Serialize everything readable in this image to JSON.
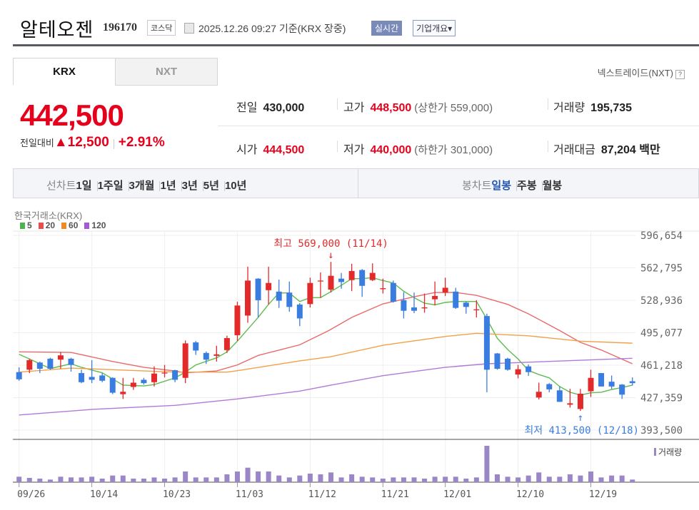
{
  "header": {
    "name": "알테오젠",
    "code": "196170",
    "market": "코스닥",
    "datetime": "2025.12.26 09:27 기준(KRX 장중)",
    "realtime": "실시간",
    "company_overview": "기업개요▾"
  },
  "tabs": [
    {
      "label": "KRX"
    },
    {
      "label": "NXT"
    }
  ],
  "nextrade": {
    "label": "넥스트레이드(NXT)",
    "help": "?"
  },
  "price": {
    "current": "442,500",
    "change_label": "전일대비",
    "change": "▲12,500",
    "rate": "+2.91%"
  },
  "stats": {
    "prev": {
      "label": "전일",
      "value": "430,000"
    },
    "high": {
      "label": "고가",
      "value": "448,500",
      "limit": "(상한가 559,000)"
    },
    "volume": {
      "label": "거래량",
      "value": "195,735"
    },
    "open": {
      "label": "시가",
      "value": "444,500"
    },
    "low": {
      "label": "저가",
      "value": "440,000",
      "limit": "(하한가 301,000)"
    },
    "amount": {
      "label": "거래대금",
      "value": "87,204 백만"
    }
  },
  "toolbar": {
    "line_label": "선차트",
    "line_items": [
      "1일",
      "1주일",
      "3개월",
      "1년",
      "3년",
      "5년",
      "10년"
    ],
    "candle_label": "봉차트",
    "candle_items": [
      "일봉",
      "주봉",
      "월봉"
    ],
    "selected": "일봉"
  },
  "chart_meta": {
    "exchange": "한국거래소(KRX)",
    "legend": [
      {
        "label": "5",
        "color": "#4db34d"
      },
      {
        "label": "20",
        "color": "#e84c4c"
      },
      {
        "label": "60",
        "color": "#f08a24"
      },
      {
        "label": "120",
        "color": "#a25bd4"
      }
    ],
    "volume_legend": "거래량",
    "up_color": "#e32a2a",
    "down_color": "#3a7de0",
    "volume_color": "#9b86c6"
  },
  "chart_data": {
    "type": "candlestick",
    "y_ticks": [
      {
        "value": 596654,
        "label": "596,654"
      },
      {
        "value": 562795,
        "label": "562,795"
      },
      {
        "value": 528936,
        "label": "528,936"
      },
      {
        "value": 495077,
        "label": "495,077"
      },
      {
        "value": 461218,
        "label": "461,218"
      },
      {
        "value": 427359,
        "label": "427,359"
      },
      {
        "value": 393500,
        "label": "393,500"
      }
    ],
    "x_ticks": [
      {
        "index": 1,
        "label": "09/26"
      },
      {
        "index": 8,
        "label": "10/14"
      },
      {
        "index": 15,
        "label": "10/23"
      },
      {
        "index": 22,
        "label": "11/03"
      },
      {
        "index": 29,
        "label": "11/12"
      },
      {
        "index": 36,
        "label": "11/21"
      },
      {
        "index": 42,
        "label": "12/01"
      },
      {
        "index": 49,
        "label": "12/10"
      },
      {
        "index": 56,
        "label": "12/19"
      }
    ],
    "annotations": {
      "high": {
        "index": 31,
        "value": 569000,
        "label": "최고 569,000 (11/14)"
      },
      "low": {
        "index": 55,
        "value": 413500,
        "label": "최저 413,500 (12/18)"
      }
    },
    "ohlc": [
      [
        454000,
        459000,
        445000,
        446500
      ],
      [
        456500,
        468000,
        453000,
        466500
      ],
      [
        464000,
        465000,
        453000,
        457500
      ],
      [
        468000,
        469000,
        456500,
        457500
      ],
      [
        467000,
        475000,
        457500,
        471500
      ],
      [
        468000,
        469000,
        454500,
        461500
      ],
      [
        453000,
        456500,
        442500,
        443500
      ],
      [
        449000,
        466500,
        442500,
        446000
      ],
      [
        450500,
        453000,
        443500,
        445000
      ],
      [
        448000,
        448500,
        431000,
        432500
      ],
      [
        431000,
        448000,
        426000,
        433500
      ],
      [
        438500,
        448000,
        435500,
        443000
      ],
      [
        446000,
        448000,
        441000,
        442500
      ],
      [
        443500,
        460000,
        439000,
        452500
      ],
      [
        453000,
        461500,
        448500,
        453500
      ],
      [
        456000,
        456500,
        443500,
        446000
      ],
      [
        448000,
        487000,
        442500,
        484000
      ],
      [
        485000,
        486500,
        472000,
        476500
      ],
      [
        474000,
        475500,
        462500,
        467000
      ],
      [
        471000,
        481500,
        465000,
        472500
      ],
      [
        477000,
        492000,
        474000,
        489500
      ],
      [
        492500,
        527500,
        486500,
        523500
      ],
      [
        513000,
        564000,
        505500,
        549500
      ],
      [
        551500,
        552000,
        511000,
        529000
      ],
      [
        539500,
        564000,
        524500,
        547000
      ],
      [
        538000,
        550500,
        521000,
        528500
      ],
      [
        537000,
        548500,
        517000,
        522000
      ],
      [
        524500,
        526000,
        502000,
        510000
      ],
      [
        525000,
        552500,
        521500,
        547000
      ],
      [
        549000,
        558000,
        531500,
        549500
      ],
      [
        540000,
        569000,
        537000,
        554500
      ],
      [
        551500,
        557500,
        541000,
        548000
      ],
      [
        550000,
        567000,
        538500,
        559500
      ],
      [
        560500,
        561500,
        532500,
        544000
      ],
      [
        550000,
        567500,
        549000,
        557500
      ],
      [
        540500,
        551500,
        536000,
        541500
      ],
      [
        547000,
        549500,
        526500,
        527500
      ],
      [
        529000,
        537500,
        510000,
        518000
      ],
      [
        521500,
        537000,
        515500,
        518000
      ],
      [
        520500,
        536000,
        516000,
        521500
      ],
      [
        530000,
        548500,
        523500,
        533500
      ],
      [
        537000,
        552500,
        533500,
        542000
      ],
      [
        538000,
        542000,
        520000,
        521000
      ],
      [
        526500,
        527500,
        515000,
        522000
      ],
      [
        519000,
        529000,
        511000,
        519500
      ],
      [
        512500,
        515000,
        433000,
        456500
      ],
      [
        473500,
        474000,
        456500,
        457500
      ],
      [
        468000,
        469000,
        455500,
        456500
      ],
      [
        451500,
        461500,
        447500,
        457000
      ],
      [
        460000,
        462000,
        450000,
        454000
      ],
      [
        427500,
        443000,
        425500,
        433500
      ],
      [
        441500,
        442500,
        433000,
        436000
      ],
      [
        435000,
        439000,
        423000,
        423000
      ],
      [
        420000,
        436500,
        417000,
        421500
      ],
      [
        415500,
        436500,
        413500,
        431500
      ],
      [
        434000,
        456500,
        428000,
        448000
      ],
      [
        453000,
        453000,
        439000,
        439000
      ],
      [
        444000,
        450500,
        436500,
        439000
      ],
      [
        441000,
        441500,
        426000,
        430500
      ],
      [
        444500,
        448500,
        440000,
        442500
      ]
    ],
    "volume": [
      409000,
      320000,
      267000,
      196000,
      409000,
      356000,
      356000,
      409000,
      267000,
      498000,
      498000,
      267000,
      267000,
      356000,
      267000,
      356000,
      801000,
      356000,
      356000,
      356000,
      587000,
      801000,
      1086000,
      801000,
      801000,
      498000,
      356000,
      498000,
      641000,
      587000,
      730000,
      356000,
      587000,
      409000,
      356000,
      267000,
      356000,
      356000,
      356000,
      267000,
      409000,
      409000,
      409000,
      267000,
      356000,
      2723000,
      587000,
      409000,
      356000,
      498000,
      730000,
      409000,
      409000,
      587000,
      498000,
      801000,
      356000,
      498000,
      498000,
      195735
    ],
    "moving_averages": [
      {
        "name": "5",
        "color": "#5dbb4f",
        "points": [
          [
            1,
            472600
          ],
          [
            2,
            467700
          ],
          [
            4,
            457700
          ],
          [
            6,
            462700
          ],
          [
            7,
            459000
          ],
          [
            9,
            453300
          ],
          [
            11,
            440400
          ],
          [
            13,
            439600
          ],
          [
            14,
            441000
          ],
          [
            16,
            448000
          ],
          [
            17,
            454000
          ],
          [
            18,
            461500
          ],
          [
            20,
            468900
          ],
          [
            21,
            475100
          ],
          [
            22,
            486300
          ],
          [
            24,
            511100
          ],
          [
            25,
            524700
          ],
          [
            26,
            536600
          ],
          [
            27,
            536600
          ],
          [
            28,
            527700
          ],
          [
            29,
            531700
          ],
          [
            30,
            531700
          ],
          [
            31,
            538000
          ],
          [
            32,
            544600
          ],
          [
            33,
            551500
          ],
          [
            34,
            551500
          ],
          [
            35,
            552500
          ],
          [
            36,
            549500
          ],
          [
            37,
            547000
          ],
          [
            38,
            538400
          ],
          [
            39,
            531700
          ],
          [
            40,
            525900
          ],
          [
            41,
            524200
          ],
          [
            42,
            526700
          ],
          [
            43,
            527700
          ],
          [
            45,
            527700
          ],
          [
            46,
            509500
          ],
          [
            47,
            489300
          ],
          [
            48,
            477600
          ],
          [
            49,
            467700
          ],
          [
            50,
            455700
          ],
          [
            51,
            451500
          ],
          [
            52,
            448000
          ],
          [
            53,
            439000
          ],
          [
            54,
            433000
          ],
          [
            55,
            430000
          ],
          [
            56,
            432400
          ],
          [
            57,
            433000
          ],
          [
            58,
            435900
          ],
          [
            59,
            437900
          ],
          [
            60,
            440400
          ]
        ]
      },
      {
        "name": "20",
        "color": "#e86a6a",
        "points": [
          [
            1,
            475100
          ],
          [
            6,
            474600
          ],
          [
            10,
            465100
          ],
          [
            13,
            459000
          ],
          [
            16,
            455200
          ],
          [
            17,
            453300
          ],
          [
            20,
            455200
          ],
          [
            22,
            461500
          ],
          [
            24,
            471400
          ],
          [
            28,
            482500
          ],
          [
            30.8,
            497400
          ],
          [
            33,
            511100
          ],
          [
            36,
            525200
          ],
          [
            39,
            532600
          ],
          [
            41,
            537100
          ],
          [
            43,
            537100
          ],
          [
            45,
            534100
          ],
          [
            48,
            524700
          ],
          [
            50,
            514800
          ],
          [
            53,
            497400
          ],
          [
            55,
            485000
          ],
          [
            57,
            477100
          ],
          [
            60,
            462700
          ]
        ]
      },
      {
        "name": "60",
        "color": "#f2a04a",
        "points": [
          [
            1,
            454000
          ],
          [
            6,
            458200
          ],
          [
            10,
            456500
          ],
          [
            16,
            454000
          ],
          [
            21,
            454000
          ],
          [
            22,
            455500
          ],
          [
            28,
            465700
          ],
          [
            31,
            470100
          ],
          [
            36,
            482000
          ],
          [
            42,
            491200
          ],
          [
            45,
            494500
          ],
          [
            50,
            491900
          ],
          [
            55,
            486300
          ],
          [
            60,
            484200
          ]
        ]
      },
      {
        "name": "120",
        "color": "#b07ad8",
        "points": [
          [
            1,
            409300
          ],
          [
            8,
            415100
          ],
          [
            16,
            419300
          ],
          [
            22,
            426000
          ],
          [
            28,
            434200
          ],
          [
            31,
            440400
          ],
          [
            36,
            450300
          ],
          [
            42,
            459000
          ],
          [
            46,
            462700
          ],
          [
            55,
            466400
          ],
          [
            60,
            468400
          ]
        ]
      }
    ]
  }
}
